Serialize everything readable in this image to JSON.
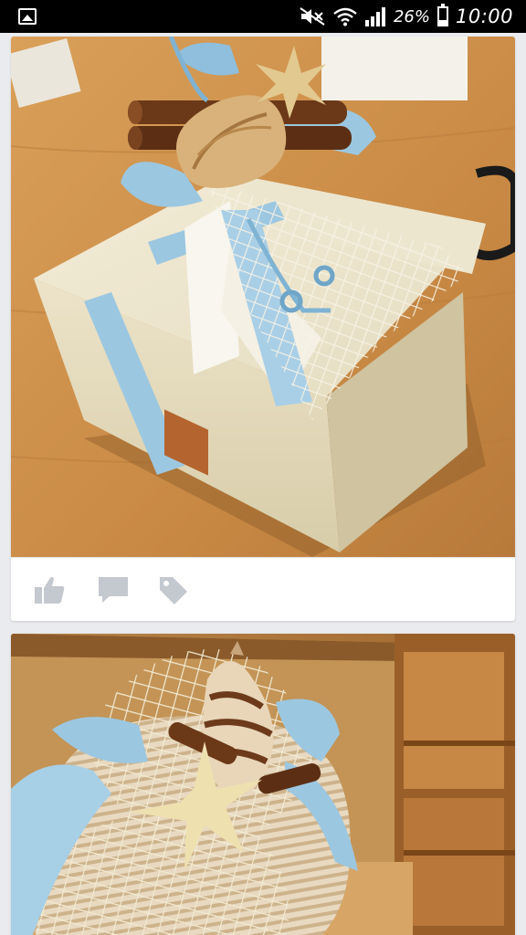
{
  "status_bar": {
    "battery_percent": "26%",
    "battery_level": 0.26,
    "time": "10:00",
    "icons": [
      "gallery-icon",
      "mute-icon",
      "wifi-icon",
      "signal-icon",
      "battery-icon"
    ]
  },
  "feed": {
    "posts": [
      {
        "photo": "gift-box-with-seashell-and-cinnamon",
        "actions": [
          "like-icon",
          "comment-icon",
          "tag-icon"
        ]
      },
      {
        "photo": "fabric-pouch-with-seashell-and-starfish"
      }
    ]
  },
  "colors": {
    "status_bar_bg": "#000000",
    "feed_bg": "#e9ebee",
    "card_bg": "#ffffff",
    "action_icon": "#c4c8cf",
    "ribbon_blue": "#9cc7e0"
  }
}
